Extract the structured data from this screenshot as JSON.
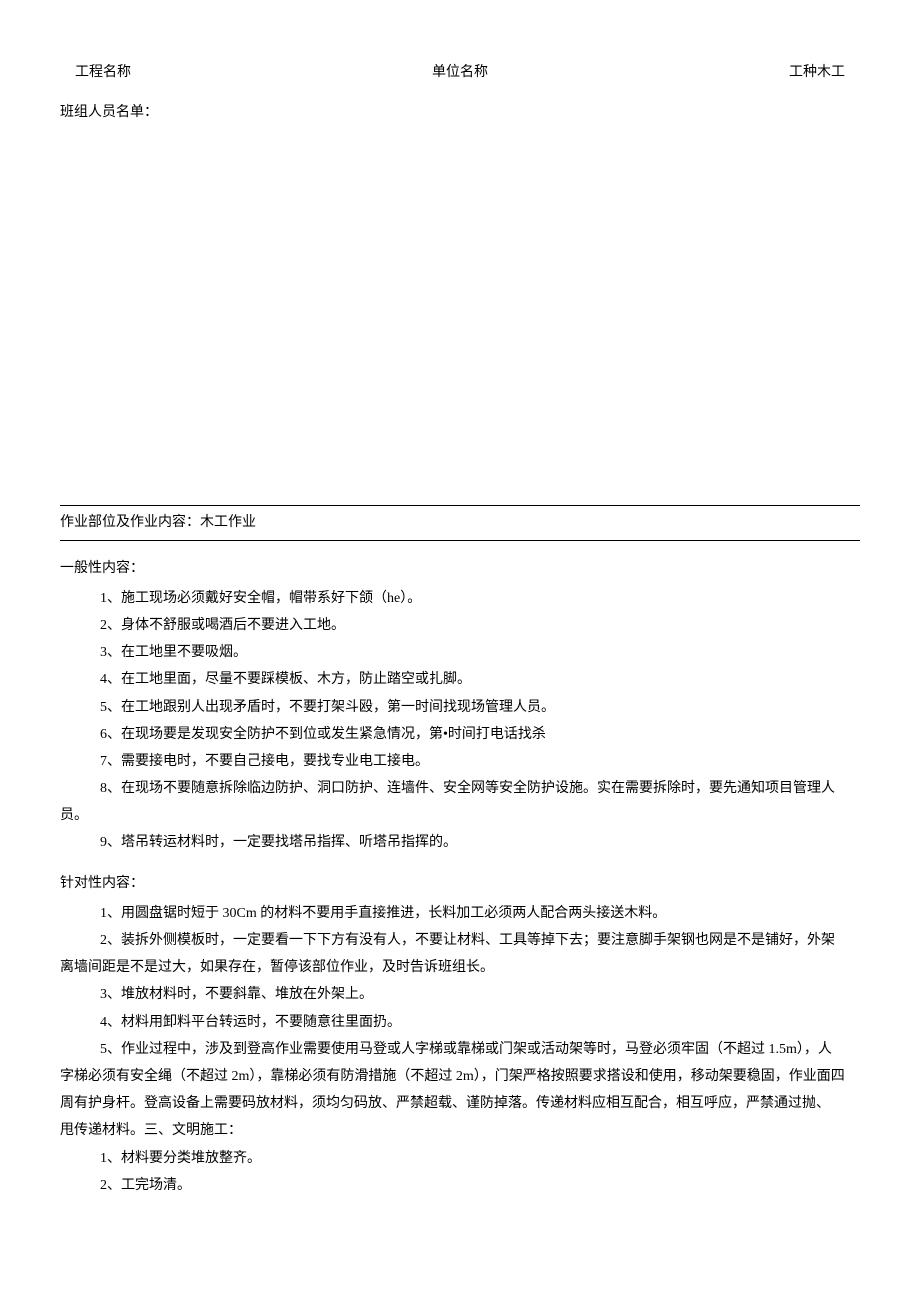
{
  "header": {
    "project_label": "工程名称",
    "unit_label": "单位名称",
    "work_type": "工种木工"
  },
  "team_list_label": "班组人员名单：",
  "section_header": "作业部位及作业内容：木工作业",
  "general": {
    "title": "一般性内容：",
    "items": [
      "1、施工现场必须戴好安全帽，帽带系好下颌（he）。",
      "2、身体不舒服或喝酒后不要进入工地。",
      "3、在工地里不要吸烟。",
      "4、在工地里面，尽量不要踩模板、木方，防止踏空或扎脚。",
      "5、在工地跟别人出现矛盾时，不要打架斗殴，第一时间找现场管理人员。",
      "6、在现场要是发现安全防护不到位或发生紧急情况，第•时间打电话找杀",
      "7、需要接电时，不要自己接电，要找专业电工接电。"
    ],
    "item8_line1": "8、在现场不要随意拆除临边防护、洞口防护、连墙件、安全网等安全防护设施。实在需要拆除时，要先通知项目管理人",
    "item8_line2": "员。",
    "item9": "9、塔吊转运材料时，一定要找塔吊指挥、听塔吊指挥的。"
  },
  "specific": {
    "title": "针对性内容：",
    "item1": "1、用圆盘锯时短于 30Cm 的材料不要用手直接推进，长料加工必须两人配合两头接送木料。",
    "item2_line1": "2、装拆外侧模板时，一定要看一下下方有没有人，不要让材料、工具等掉下去；要注意脚手架钢也网是不是铺好，外架",
    "item2_line2": "离墙间距是不是过大，如果存在，暂停该部位作业，及时告诉班组长。",
    "item3": "3、堆放材料时，不要斜靠、堆放在外架上。",
    "item4": "4、材料用卸料平台转运时，不要随意往里面扔。",
    "item5_line1": "5、作业过程中，涉及到登高作业需要使用马登或人字梯或靠梯或门架或活动架等时，马登必须牢固（不超过 1.5m），人",
    "item5_line2": "字梯必须有安全绳（不超过 2m），靠梯必须有防滑措施（不超过 2m），门架严格按照要求搭设和使用，移动架要稳固，作业面四",
    "item5_line3": "周有护身杆。登高设备上需要码放材料，须均匀码放、严禁超载、谨防掉落。传递材料应相互配合，相互呼应，严禁通过抛、",
    "item5_line4": "甩传递材料。三、文明施工：",
    "civil1": "1、材料要分类堆放整齐。",
    "civil2": "2、工完场清。"
  }
}
